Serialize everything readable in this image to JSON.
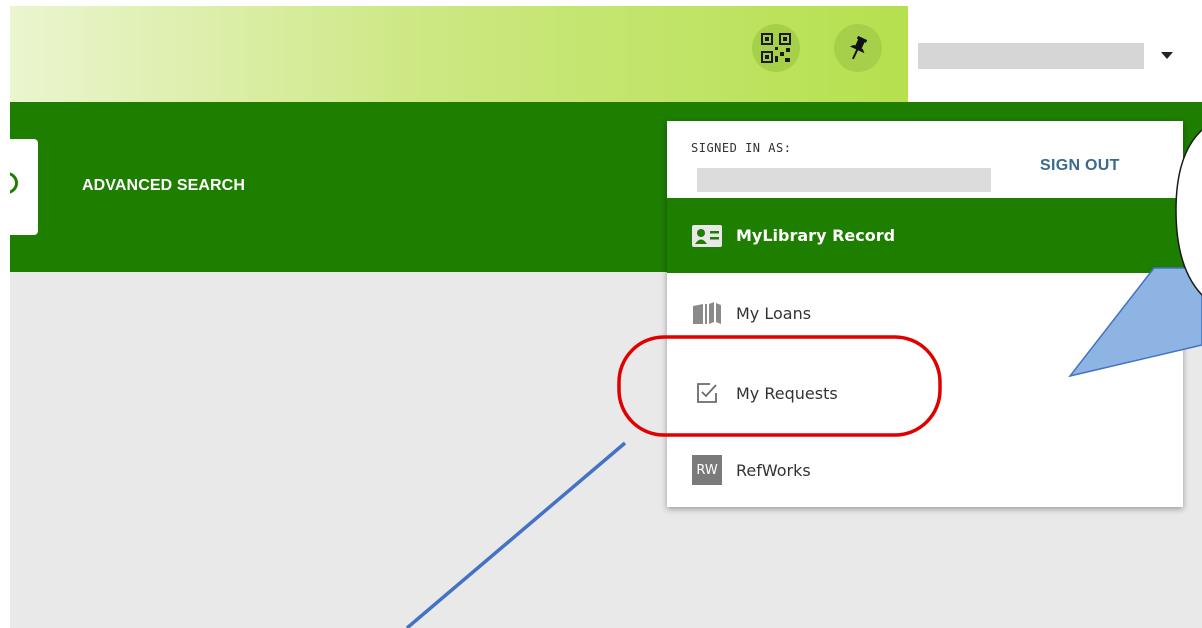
{
  "header": {
    "qr_icon": "qr-code-icon",
    "pin_icon": "pushpin-icon",
    "user_dropdown_icon": "caret-down-icon"
  },
  "nav": {
    "advanced_search": "ADVANCED SEARCH"
  },
  "user_menu": {
    "signed_in_label": "SIGNED IN AS:",
    "sign_out": "SIGN OUT",
    "items": [
      {
        "label": "MyLibrary Record",
        "icon": "id-card-icon",
        "active": true
      },
      {
        "label": "My Loans",
        "icon": "open-book-icon",
        "active": false
      },
      {
        "label": "My Requests",
        "icon": "checkbox-icon",
        "active": false
      },
      {
        "label": "RefWorks",
        "icon": "refworks-logo-icon",
        "badge": "RW",
        "active": false
      }
    ]
  },
  "colors": {
    "nav_green": "#1e7e00",
    "header_gradient_start": "#ebf5cf",
    "header_gradient_end": "#b6e04e",
    "content_bg": "#e9e9e9",
    "sign_out_blue": "#3a6b8f",
    "highlight_red": "#e00000",
    "callout_blue": "#8eb4e3",
    "arrow_blue": "#4472c4"
  }
}
